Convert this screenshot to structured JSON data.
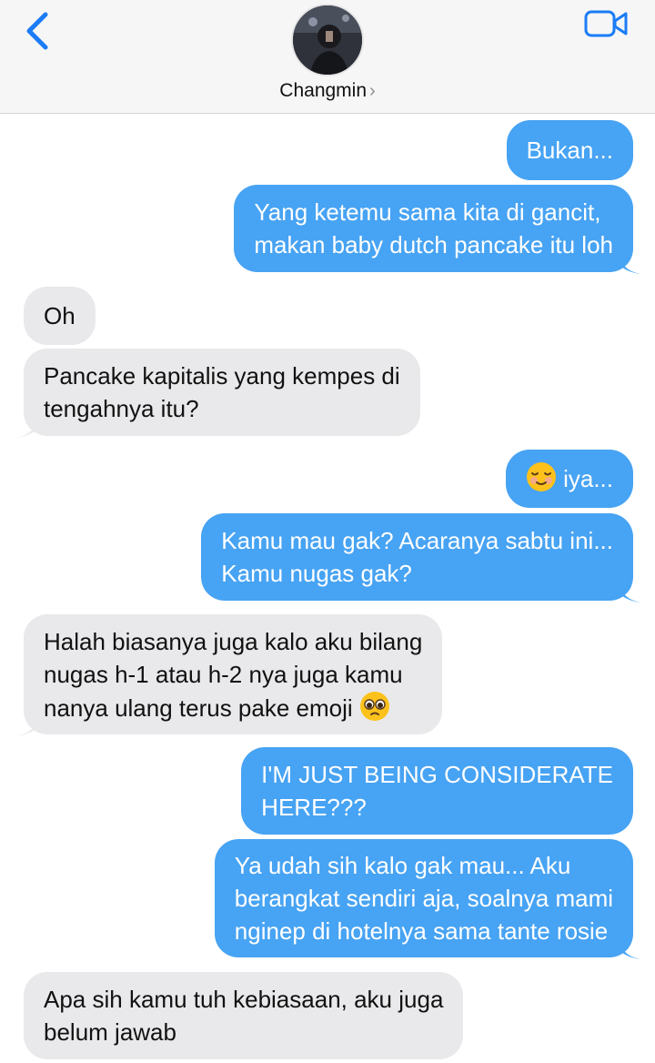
{
  "header": {
    "contact_name": "Changmin",
    "back_icon": "chevron-left-icon",
    "video_icon": "video-camera-icon",
    "accent": "#1b7cf6"
  },
  "colors": {
    "sent_bubble": "#47a3f3",
    "received_bubble": "#e9e9eb"
  },
  "messages": [
    {
      "from": "me",
      "lines": [
        "Bukan..."
      ]
    },
    {
      "from": "me",
      "lines": [
        "Yang ketemu sama kita di gancit,",
        "makan baby dutch pancake itu loh"
      ]
    },
    {
      "from": "them",
      "lines": [
        "Oh"
      ]
    },
    {
      "from": "them",
      "lines": [
        "Pancake kapitalis yang kempes di",
        "tengahnya itu?"
      ]
    },
    {
      "from": "me",
      "emoji": "smiling-face-emoji",
      "lines": [
        "iya..."
      ]
    },
    {
      "from": "me",
      "lines": [
        "Kamu mau gak? Acaranya sabtu ini...",
        "Kamu nugas gak?"
      ]
    },
    {
      "from": "them",
      "lines": [
        "Halah biasanya juga kalo aku bilang",
        "nugas h-1 atau h-2 nya juga kamu",
        "nanya ulang terus pake emoji"
      ],
      "emoji": "pleading-face-emoji"
    },
    {
      "from": "me",
      "lines": [
        "I'M JUST BEING CONSIDERATE",
        "HERE???"
      ]
    },
    {
      "from": "me",
      "lines": [
        "Ya udah sih kalo gak mau... Aku",
        "berangkat sendiri aja, soalnya mami",
        "nginep di hotelnya sama tante rosie"
      ]
    },
    {
      "from": "them",
      "lines": [
        "Apa sih kamu tuh kebiasaan, aku juga",
        "belum jawab"
      ]
    }
  ]
}
